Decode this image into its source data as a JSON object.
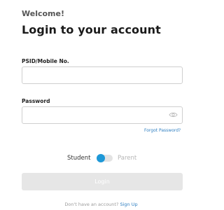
{
  "header": {
    "welcome": "Welcome!",
    "title": "Login to your account"
  },
  "form": {
    "psid_label": "PSID/Mobile No.",
    "psid_value": "",
    "psid_placeholder": "",
    "password_label": "Password",
    "password_value": "",
    "password_placeholder": "",
    "password_toggle_icon": "eye-icon",
    "forgot_link": "Forgot Password?"
  },
  "role_toggle": {
    "student_label": "Student",
    "parent_label": "Parent",
    "selected": "Student"
  },
  "actions": {
    "login_label": "Login",
    "signup_prompt": "Don't have an account?",
    "signup_link": "Sign Up"
  },
  "colors": {
    "accent": "#1e98d7",
    "link": "#2f7fc1",
    "button_disabled": "#e6e6e6"
  }
}
